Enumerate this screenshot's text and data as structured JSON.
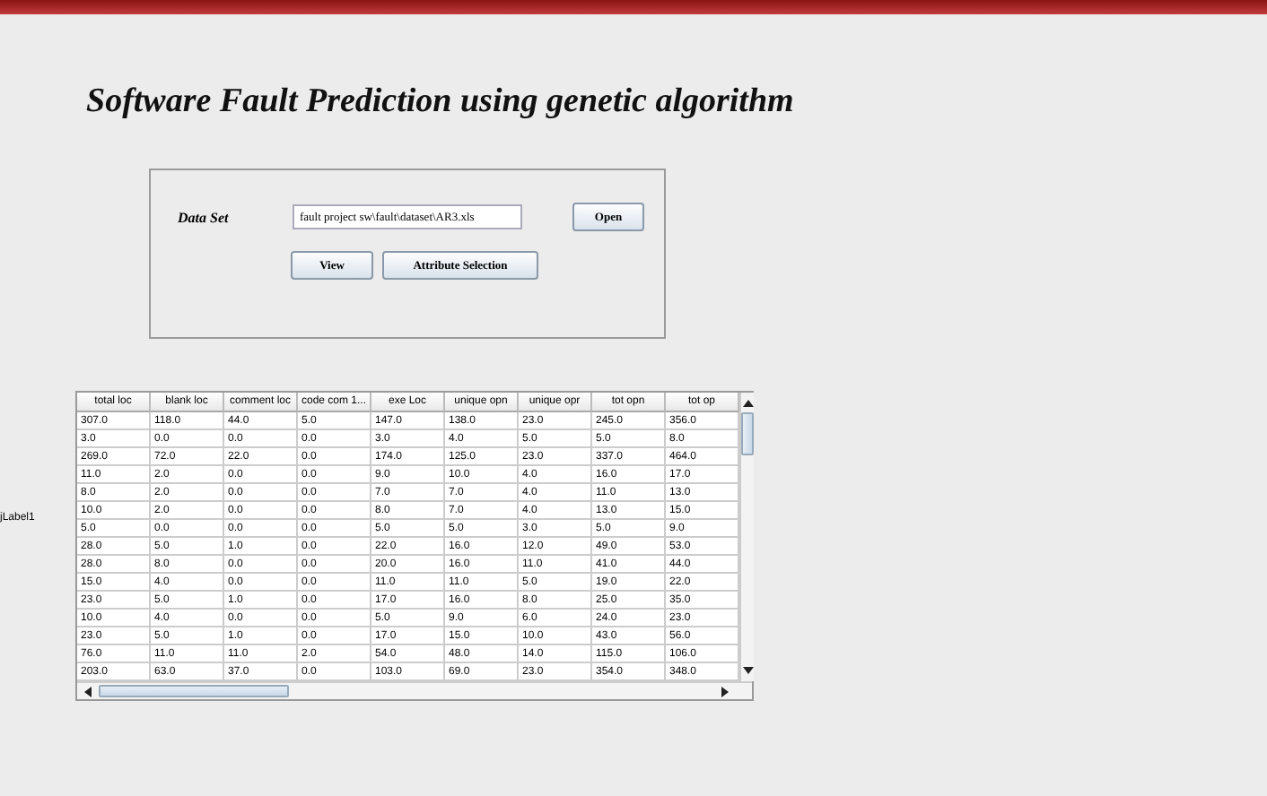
{
  "title": "Software Fault Prediction using genetic algorithm",
  "dataset": {
    "label": "Data Set",
    "value": "fault project sw\\fault\\dataset\\AR3.xls",
    "open_button": "Open",
    "view_button": "View",
    "attribute_button": "Attribute Selection"
  },
  "side_label": "jLabel1",
  "table": {
    "columns": [
      "total loc",
      "blank loc",
      "comment loc",
      "code com 1...",
      "exe Loc",
      "unique opn",
      "unique opr",
      "tot opn",
      "tot op"
    ],
    "rows": [
      [
        "307.0",
        "118.0",
        "44.0",
        "5.0",
        "147.0",
        "138.0",
        "23.0",
        "245.0",
        "356.0"
      ],
      [
        "3.0",
        "0.0",
        "0.0",
        "0.0",
        "3.0",
        "4.0",
        "5.0",
        "5.0",
        "8.0"
      ],
      [
        "269.0",
        "72.0",
        "22.0",
        "0.0",
        "174.0",
        "125.0",
        "23.0",
        "337.0",
        "464.0"
      ],
      [
        "11.0",
        "2.0",
        "0.0",
        "0.0",
        "9.0",
        "10.0",
        "4.0",
        "16.0",
        "17.0"
      ],
      [
        "8.0",
        "2.0",
        "0.0",
        "0.0",
        "7.0",
        "7.0",
        "4.0",
        "11.0",
        "13.0"
      ],
      [
        "10.0",
        "2.0",
        "0.0",
        "0.0",
        "8.0",
        "7.0",
        "4.0",
        "13.0",
        "15.0"
      ],
      [
        "5.0",
        "0.0",
        "0.0",
        "0.0",
        "5.0",
        "5.0",
        "3.0",
        "5.0",
        "9.0"
      ],
      [
        "28.0",
        "5.0",
        "1.0",
        "0.0",
        "22.0",
        "16.0",
        "12.0",
        "49.0",
        "53.0"
      ],
      [
        "28.0",
        "8.0",
        "0.0",
        "0.0",
        "20.0",
        "16.0",
        "11.0",
        "41.0",
        "44.0"
      ],
      [
        "15.0",
        "4.0",
        "0.0",
        "0.0",
        "11.0",
        "11.0",
        "5.0",
        "19.0",
        "22.0"
      ],
      [
        "23.0",
        "5.0",
        "1.0",
        "0.0",
        "17.0",
        "16.0",
        "8.0",
        "25.0",
        "35.0"
      ],
      [
        "10.0",
        "4.0",
        "0.0",
        "0.0",
        "5.0",
        "9.0",
        "6.0",
        "24.0",
        "23.0"
      ],
      [
        "23.0",
        "5.0",
        "1.0",
        "0.0",
        "17.0",
        "15.0",
        "10.0",
        "43.0",
        "56.0"
      ],
      [
        "76.0",
        "11.0",
        "11.0",
        "2.0",
        "54.0",
        "48.0",
        "14.0",
        "115.0",
        "106.0"
      ],
      [
        "203.0",
        "63.0",
        "37.0",
        "0.0",
        "103.0",
        "69.0",
        "23.0",
        "354.0",
        "348.0"
      ]
    ]
  }
}
